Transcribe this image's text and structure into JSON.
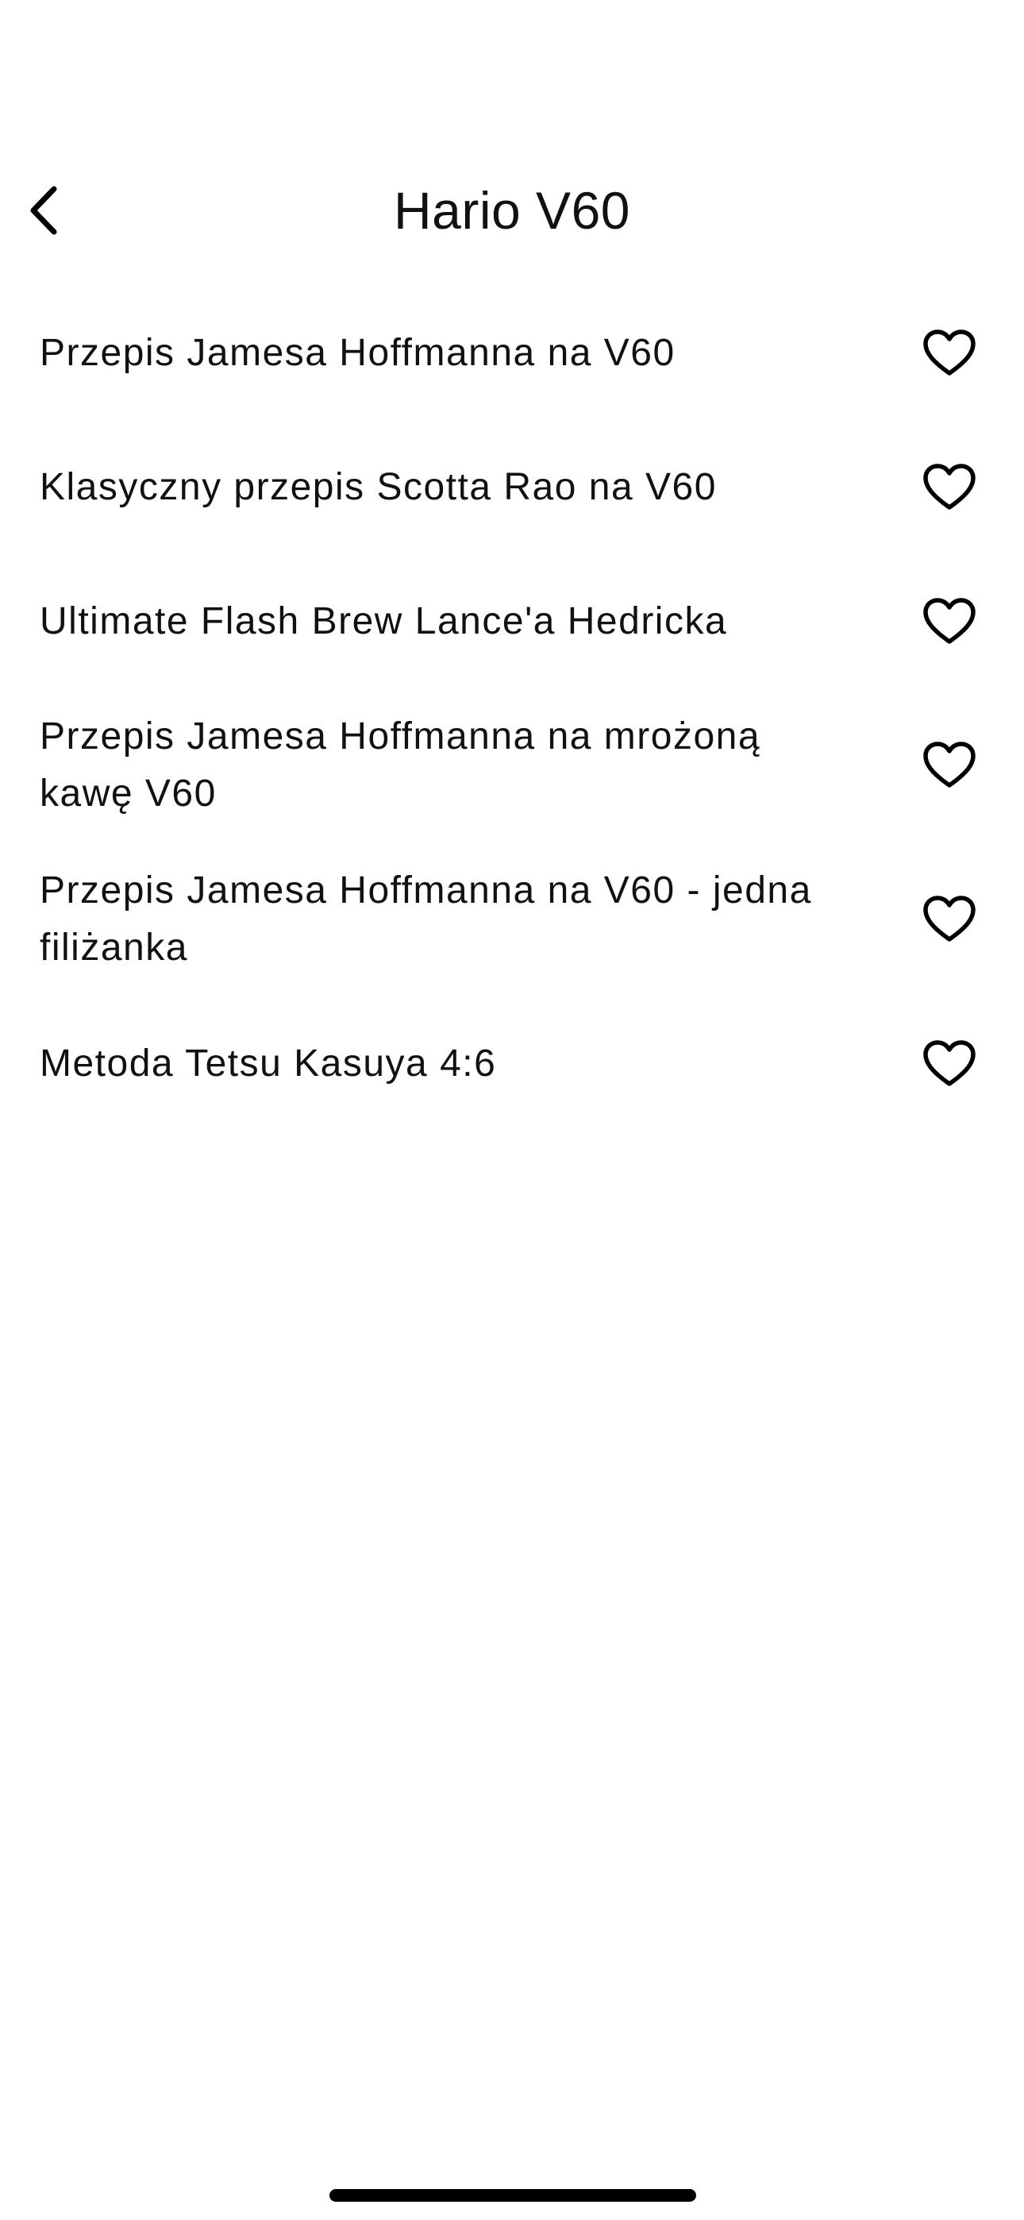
{
  "header": {
    "title": "Hario V60",
    "back_icon": "chevron-left-icon"
  },
  "recipes": [
    {
      "label": "Przepis Jamesa Hoffmanna na V60",
      "favorite": false,
      "icon": "heart-outline-icon"
    },
    {
      "label": "Klasyczny przepis Scotta Rao na V60",
      "favorite": false,
      "icon": "heart-outline-icon"
    },
    {
      "label": "Ultimate Flash Brew Lance'a Hedricka",
      "favorite": false,
      "icon": "heart-outline-icon"
    },
    {
      "label": "Przepis Jamesa Hoffmanna na mrożoną kawę V60",
      "favorite": false,
      "icon": "heart-outline-icon"
    },
    {
      "label": "Przepis Jamesa Hoffmanna na V60 - jedna filiżanka",
      "favorite": false,
      "icon": "heart-outline-icon"
    },
    {
      "label": "Metoda Tetsu Kasuya 4:6",
      "favorite": false,
      "icon": "heart-outline-icon"
    }
  ],
  "colors": {
    "background": "#ffffff",
    "text": "#111111",
    "icon": "#000000"
  }
}
